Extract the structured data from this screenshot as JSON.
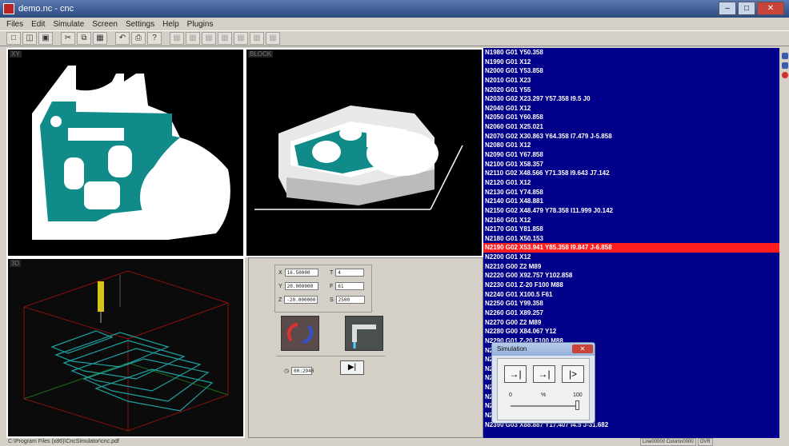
{
  "window": {
    "title": "demo.nc - cnc",
    "min_label": "–",
    "max_label": "□",
    "close_label": "✕"
  },
  "menu": [
    "Files",
    "Edit",
    "Simulate",
    "Screen",
    "Settings",
    "Help",
    "Plugins"
  ],
  "toolbar_icons": [
    "new-file",
    "open-folder",
    "save",
    "cut",
    "copy",
    "paste",
    "undo",
    "print",
    "help",
    "view-xy",
    "view-yz",
    "view-xz",
    "view-a",
    "view-b",
    "view-c",
    "view-d"
  ],
  "panes": {
    "top_left_label": "XY",
    "top_mid_label": "BLOCK",
    "bottom_left_label": "3D"
  },
  "coords": {
    "x_label": "X",
    "x_value": "16.50000",
    "y_label": "Y",
    "y_value": "20.000000",
    "z_label": "Z",
    "z_value": "-20.000000",
    "t_label": "T",
    "t_value": "4",
    "f_label": "F",
    "f_value": "61",
    "s_label": "S",
    "s_value": "2500",
    "timer": "00:2940"
  },
  "palette_colors": [
    "#ffffff",
    "#000000",
    "#ff00ff",
    "#ff0000",
    "#ffff00",
    "#00ff00",
    "#00ffff",
    "#c0c0c0",
    "#808080",
    "#800080",
    "#800000",
    "#808000",
    "#008000",
    "#008080",
    "#000080",
    "#000080"
  ],
  "code_lines": [
    "N1980 G01 Y50.358",
    "N1990 G01 X12",
    "N2000 G01 Y53.858",
    "N2010 G01 X23",
    "N2020 G01 Y55",
    "N2030 G02 X23.297 Y57.358 I9.5 J0",
    "N2040 G01 X12",
    "N2050 G01 Y60.858",
    "N2060 G01 X25.021",
    "N2070 G02 X30.863 Y64.358 I7.479 J-5.858",
    "N2080 G01 X12",
    "N2090 G01 Y67.858",
    "N2100 G01 X58.357",
    "N2110 G02 X48.566 Y71.358 I9.643 J7.142",
    "N2120 G01 X12",
    "N2130 G01 Y74.858",
    "N2140 G01 X48.881",
    "N2150 G02 X48.479 Y78.358 I11.999 J0.142",
    "N2160 G01 X12",
    "N2170 G01 Y81.858",
    "N2180 G01 X50.153",
    "N2190 G02 X53.941 Y85.358 I9.847 J-6.858",
    "N2200 G01 X12",
    "N2210 G00 Z2 M89",
    "N2220 G00 X92.757 Y102.858",
    "N2230 G01 Z-20 F100 M88",
    "N2240 G01 X100.5 F61",
    "N2250 G01 Y99.358",
    "N2260 G01 X89.257",
    "N2270 G00 Z2 M89",
    "N2280 G00 X84.067 Y12",
    "N2290 G01 Z-20 F100 M88",
    "N2",
    "N2",
    "N2",
    "N2                                        71 J5.543",
    "N2",
    "N2",
    "N2                                        2.121 J-2.121",
    "N2",
    "N2390 G03 X88.887 Y17.407 I4.5 J-31.682"
  ],
  "highlight_index": 21,
  "simulation": {
    "title": "Simulation",
    "close": "✕",
    "btn_step": "→|",
    "btn_run": "→|",
    "btn_stop": "|>",
    "min": "0",
    "mid": "%",
    "max": "100",
    "speed_fraction": 0.98
  },
  "status": {
    "path": "C:\\Program Files (x86)\\CncSimulator\\cnc.pdf",
    "position": "Line00000 Column0000",
    "mode": "OVR"
  }
}
